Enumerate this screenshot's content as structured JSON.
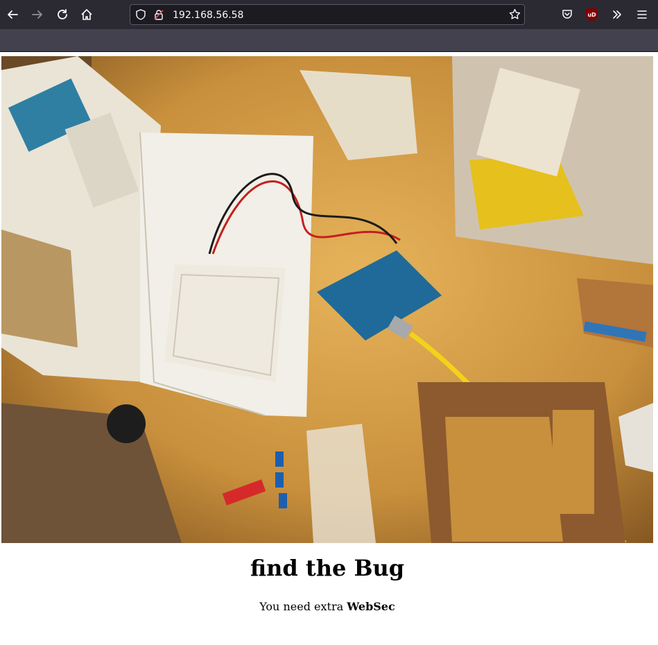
{
  "browser": {
    "url": "192.168.56.58",
    "icons": {
      "back": "back-arrow-icon",
      "forward": "forward-arrow-icon",
      "reload": "reload-icon",
      "home": "home-icon",
      "tracking": "shield-icon",
      "insecure": "insecure-lock-icon",
      "bookmark": "star-icon",
      "pocket": "pocket-icon",
      "ublock": "ublock-origin-icon",
      "overflow": "chevron-double-right-icon",
      "menu": "hamburger-menu-icon"
    },
    "ublock_label": "uD"
  },
  "page": {
    "hero_alt": "Arduino starter kit on a wooden desk",
    "title": "find the Bug",
    "subtitle_prefix": "You need extra ",
    "subtitle_strong": "WebSec"
  },
  "colors": {
    "toolbar": "#2b2a33",
    "tabstrip": "#42414d",
    "urlbar": "#1c1b22",
    "text": "#000000"
  }
}
